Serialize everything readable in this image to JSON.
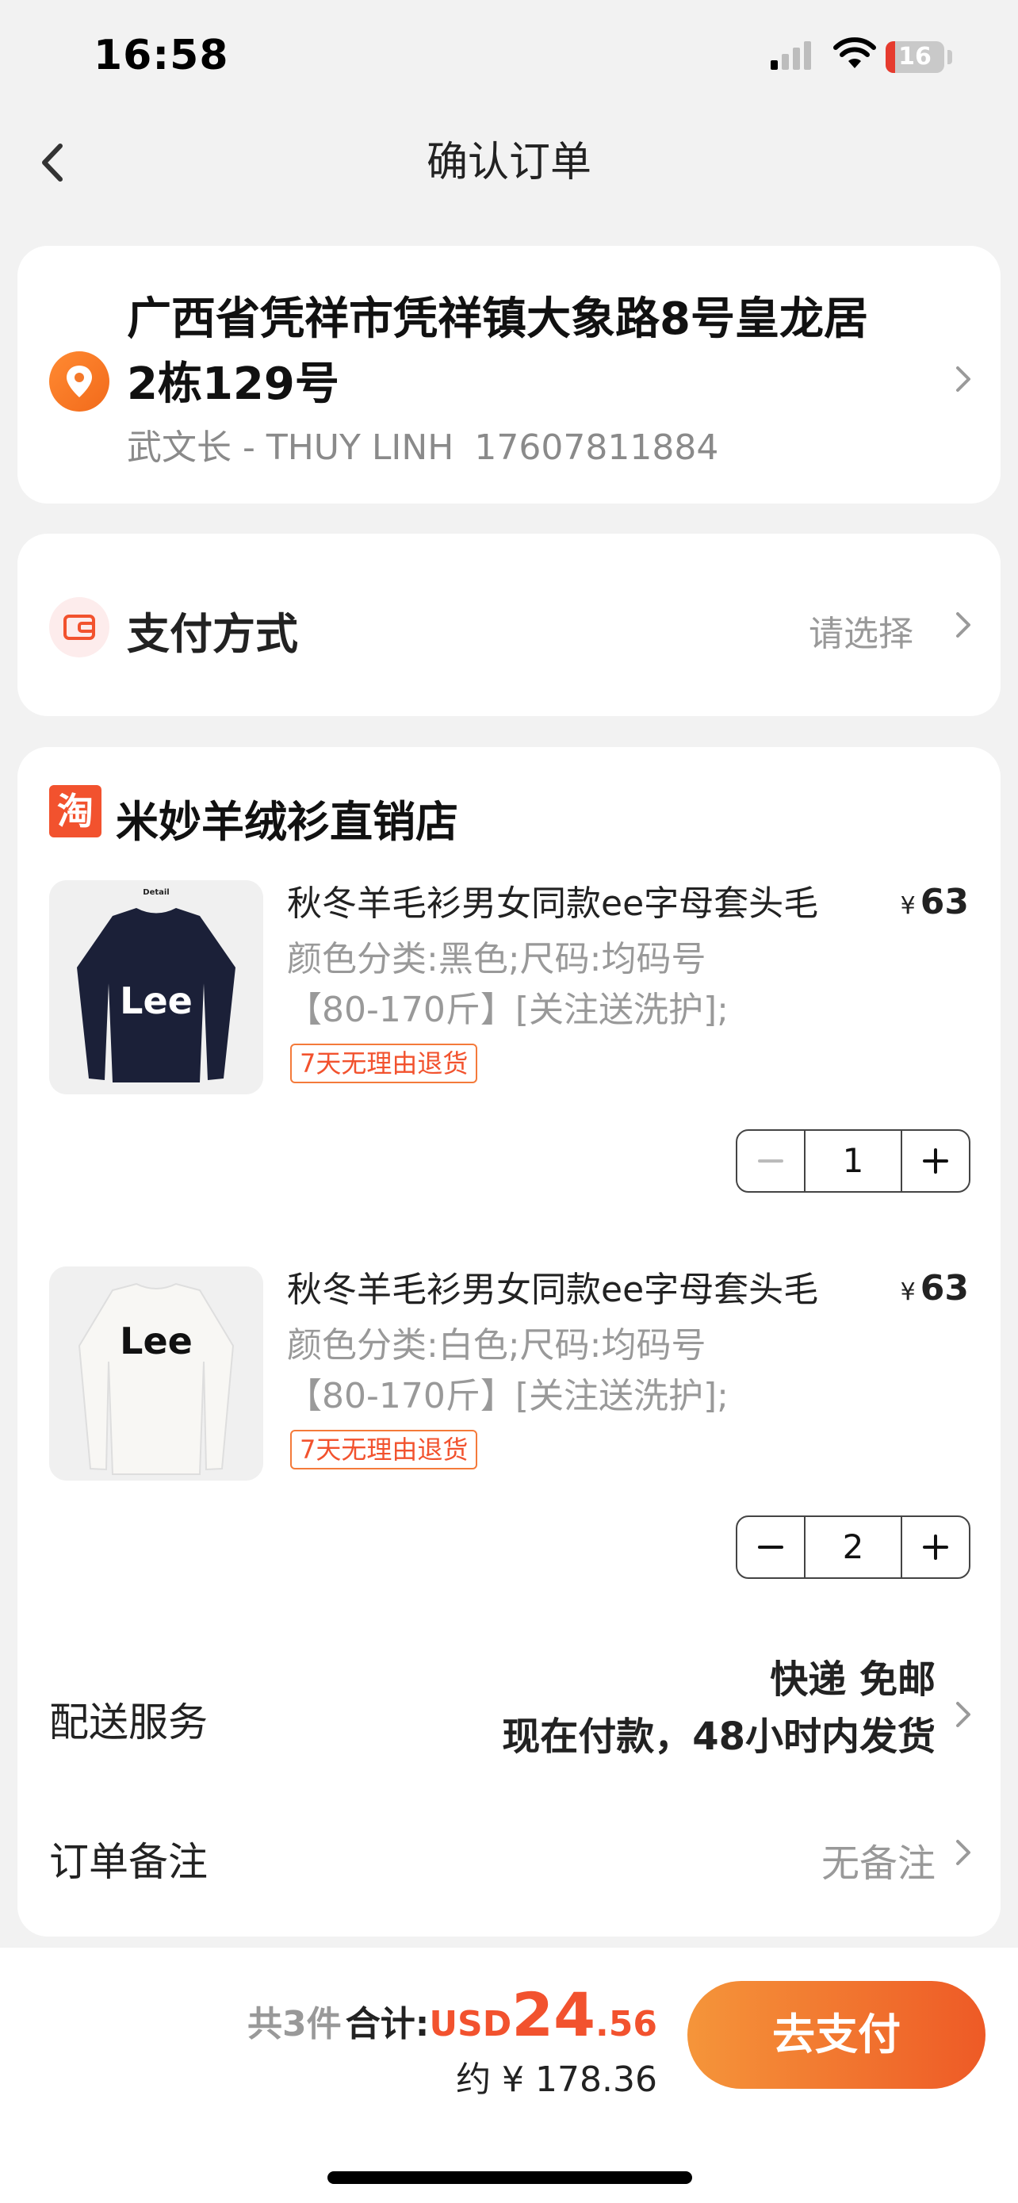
{
  "status": {
    "time": "16:58",
    "battery": "16",
    "battery_level": 0.16
  },
  "nav": {
    "title": "确认订单"
  },
  "address": {
    "full": "广西省凭祥市凭祥镇大象路8号皇龙居2栋129号",
    "contact": "武文长 - THUY LINH",
    "phone": "17607811884"
  },
  "payment": {
    "label": "支付方式",
    "placeholder": "请选择"
  },
  "shop": {
    "badge": "淘",
    "name": "米妙羊绒衫直销店"
  },
  "products": [
    {
      "title": "秋冬羊毛衫男女同款ee字母套头毛",
      "price_symbol": "¥",
      "price": "63",
      "spec_line1": "颜色分类:黑色;尺码:均码号",
      "spec_line2": "【80-170斤】[关注送洗护];",
      "tag": "7天无理由退货",
      "quantity": "1",
      "image_label": "Detail",
      "image_brand": "Lee",
      "image_color": "#1b2038"
    },
    {
      "title": "秋冬羊毛衫男女同款ee字母套头毛",
      "price_symbol": "¥",
      "price": "63",
      "spec_line1": "颜色分类:白色;尺码:均码号",
      "spec_line2": "【80-170斤】[关注送洗护];",
      "tag": "7天无理由退货",
      "quantity": "2",
      "image_brand": "Lee",
      "image_color": "#f4f2ee"
    }
  ],
  "delivery": {
    "label": "配送服务",
    "line1": "快递 免邮",
    "line2": "现在付款，48小时内发货"
  },
  "note": {
    "label": "订单备注",
    "value": "无备注"
  },
  "summary": {
    "count": "共3件",
    "total_label": "合计:",
    "currency": "USD",
    "amount_int": "24",
    "amount_dec": ".56",
    "approx": "约 ¥ 178.36",
    "pay_button": "去支付"
  },
  "colors": {
    "accent": "#f2522e",
    "pay_gradient_start": "#f5953a",
    "pay_gradient_end": "#ee5a26"
  }
}
